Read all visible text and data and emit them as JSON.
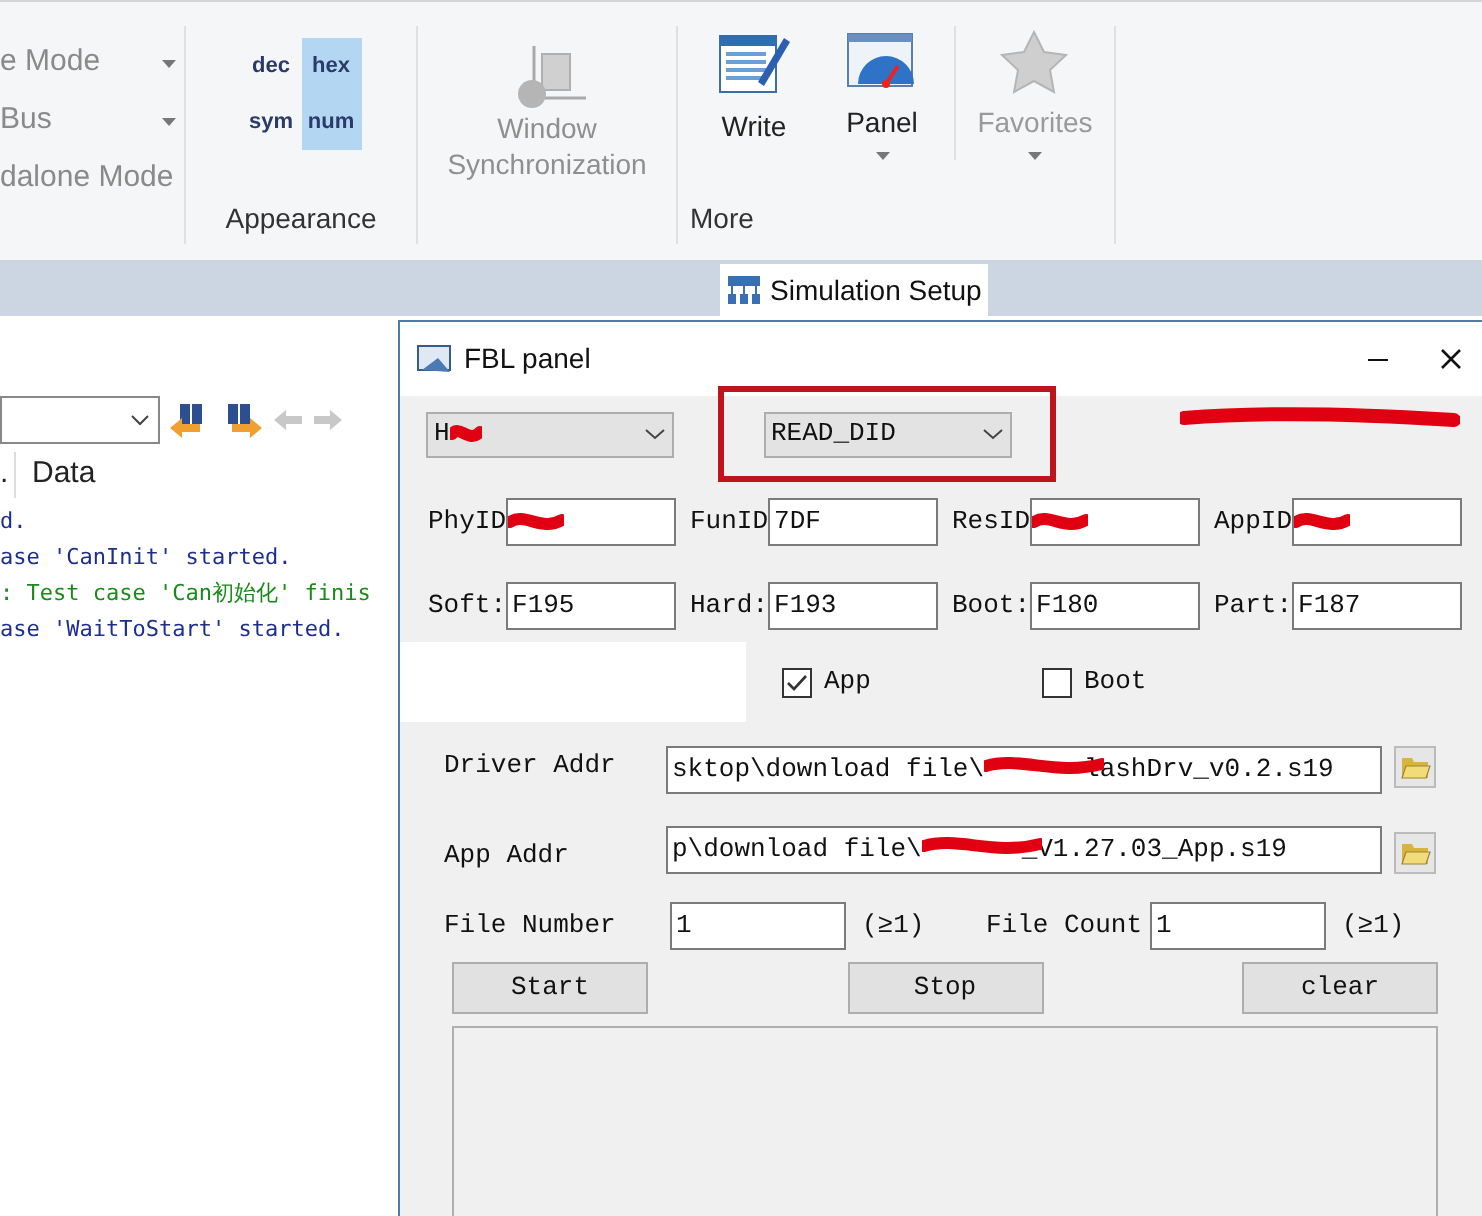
{
  "ribbon": {
    "mode_items": [
      {
        "label": "e Mode",
        "dropdown": true
      },
      {
        "label": "Bus",
        "dropdown": true
      },
      {
        "label": "dalone Mode",
        "dropdown": false
      }
    ],
    "appearance": {
      "title": "Appearance",
      "options": [
        {
          "label": "dec",
          "selected": false
        },
        {
          "label": "hex",
          "selected": true
        },
        {
          "label": "sym",
          "selected": false
        },
        {
          "label": "num",
          "selected": true
        }
      ]
    },
    "window_sync": {
      "label": "Window Synchronization",
      "disabled": true
    },
    "more": {
      "title": "More",
      "buttons": [
        {
          "kind": "write",
          "label": "Write",
          "disabled": false,
          "dropdown": false
        },
        {
          "kind": "panel",
          "label": "Panel",
          "disabled": false,
          "dropdown": true
        },
        {
          "kind": "favorites",
          "label": "Favorites",
          "disabled": true,
          "dropdown": true
        }
      ]
    }
  },
  "doc_tab": {
    "label": "Simulation Setup"
  },
  "trace": {
    "column_1": ".",
    "column_2": "Data",
    "lines": [
      {
        "text": "d.",
        "color": "#1c2f8c"
      },
      {
        "text": "ase 'CanInit' started.",
        "color": "#1c2f8c"
      },
      {
        "text": ": Test case 'Can初始化' finis",
        "color": "#1a8a1a"
      },
      {
        "text": "ase 'WaitToStart' started.",
        "color": "#1c2f8c"
      }
    ]
  },
  "fbl_panel": {
    "title": "FBL panel",
    "header_redacted": true,
    "combos": [
      {
        "value": "H",
        "redacted": true,
        "highlighted": false
      },
      {
        "value": "READ_DID",
        "redacted": false,
        "highlighted": true
      }
    ],
    "ids": [
      {
        "label": "PhyID",
        "redacted": true
      },
      {
        "label": "FunID",
        "value": "7DF",
        "redacted": false
      },
      {
        "label": "ResID",
        "redacted": true
      },
      {
        "label": "AppID",
        "redacted": true
      }
    ],
    "versions": [
      {
        "label": "Soft:",
        "value": "F195"
      },
      {
        "label": "Hard:",
        "value": "F193"
      },
      {
        "label": "Boot:",
        "value": "F180"
      },
      {
        "label": "Part:",
        "value": "F187"
      }
    ],
    "checkboxes": [
      {
        "label": "App",
        "checked": true
      },
      {
        "label": "Boot",
        "checked": false
      }
    ],
    "paths": [
      {
        "label": "Driver Addr",
        "value_start": "sktop\\download file\\",
        "value_end": "lashDrv_v0.2.s19",
        "redacted": true
      },
      {
        "label": "App Addr",
        "value_start": "p\\download file\\",
        "value_end": "_V1.27.03_App.s19",
        "redacted": true
      }
    ],
    "counts": [
      {
        "label": "File Number",
        "value": "1",
        "hint": "(≥1)"
      },
      {
        "label": "File Count",
        "value": "1",
        "hint": "(≥1)"
      }
    ],
    "buttons": [
      "Start",
      "Stop",
      "clear"
    ]
  }
}
